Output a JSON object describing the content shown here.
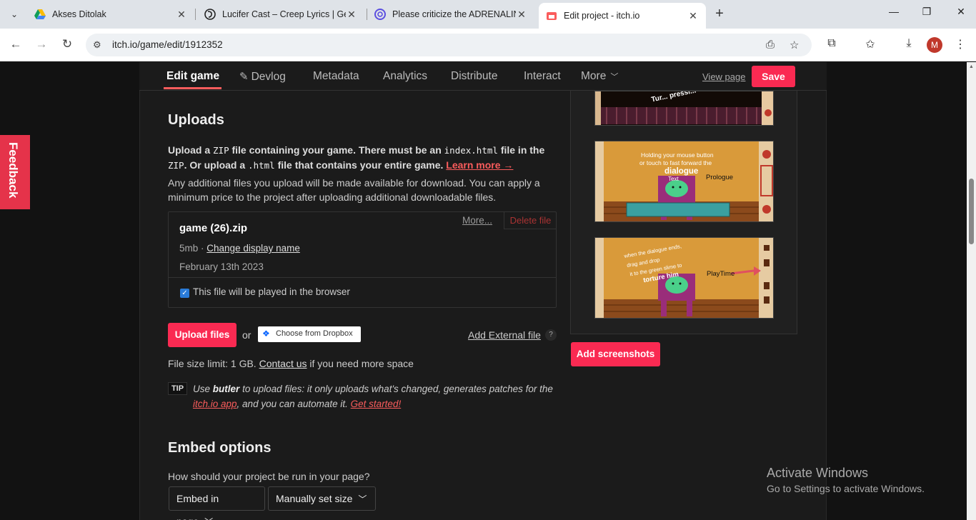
{
  "browser": {
    "tabs": [
      {
        "title": "Akses Ditolak",
        "icon": "google-drive-icon"
      },
      {
        "title": "Lucifer Cast – Creep Lyrics | Gen",
        "icon": "genius-icon"
      },
      {
        "title": "Please criticize the ADRENALIN",
        "icon": "reddit-like-icon"
      },
      {
        "title": "Edit project - itch.io",
        "icon": "itchio-icon"
      }
    ],
    "url": "itch.io/game/edit/1912352",
    "profile_initial": "M"
  },
  "topnav": {
    "items": [
      "Edit game",
      "Devlog",
      "Metadata",
      "Analytics",
      "Distribute",
      "Interact",
      "More"
    ],
    "view_page": "View page",
    "save": "Save"
  },
  "feedback": "Feedback",
  "uploads": {
    "heading": "Uploads",
    "intro_1": "Upload a",
    "intro_zip": "ZIP",
    "intro_2": "file containing your game. There must be an",
    "intro_index": "index.html",
    "intro_3": "file in the",
    "intro_zip2": "ZIP",
    "intro_4": ". Or upload a",
    "intro_html": ".html",
    "intro_5": "file that contains your entire game.",
    "learn_more": "Learn more →",
    "additional": "Any additional files you upload will be made available for download. You can apply a minimum price to the project after uploading additional downloadable files.",
    "file": {
      "name": "game (26).zip",
      "size": "5mb ·",
      "change_name": "Change display name",
      "date": "February 13th 2023",
      "more": "More...",
      "delete": "Delete file",
      "played_label": "This file will be played in the browser",
      "played": true
    },
    "upload_btn": "Upload files",
    "or": "or",
    "dropbox": "Choose from Dropbox",
    "add_external": "Add External file",
    "help": "?",
    "limit_1": "File size limit: 1 GB.",
    "contact": "Contact us",
    "limit_2": "if you need more space",
    "tip_badge": "TIP",
    "tip_1": "Use",
    "tip_butler": "butler",
    "tip_2": "to upload files: it only uploads what's changed, generates patches for the",
    "tip_app": "itch.io app",
    "tip_3": ", and you can automate it.",
    "tip_started": "Get started!"
  },
  "embed": {
    "heading": "Embed options",
    "question": "How should your project be run in your page?",
    "mode": "Embed in page",
    "size": "Manually set size"
  },
  "screenshots": {
    "add": "Add screenshots",
    "shot1_text": "Tur... pressi...",
    "shot2_text1": "Holding your mouse button",
    "shot2_text2": "or touch to fast forward the",
    "shot2_text3": "dialogue",
    "shot2_label": "Prologue",
    "shot2_small": "Text",
    "shot3_text1": "when the dialogue ends,",
    "shot3_text2": "drag and drop",
    "shot3_text3": "it to the green slime to",
    "shot3_text4": "torture him",
    "shot3_label": "PlayTime"
  },
  "watermark": {
    "line1": "Activate Windows",
    "line2": "Go to Settings to activate Windows."
  },
  "colors": {
    "accent": "#fa2a52",
    "link": "#fa5c5c"
  }
}
